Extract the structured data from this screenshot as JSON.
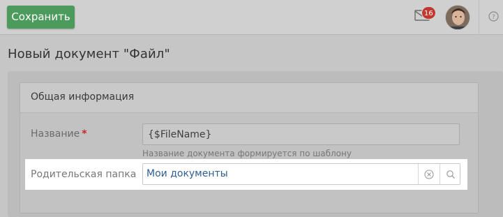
{
  "toolbar": {
    "save_label": "Сохранить",
    "notifications_count": "16",
    "mail_icon": "envelope-icon",
    "help_icon": "question-circle-icon"
  },
  "page": {
    "title": "Новый документ \"Файл\""
  },
  "section": {
    "title": "Общая информация"
  },
  "fields": {
    "name": {
      "label": "Название",
      "required_mark": "*",
      "value": "{$FileName}",
      "hint": "Название документа формируется по шаблону"
    },
    "parent_folder": {
      "label": "Родительская папка",
      "value": "Мои документы"
    }
  },
  "colors": {
    "accent_green": "#4c9a5c",
    "badge_red": "#c23a2f",
    "link_blue": "#2f5f94",
    "required_red": "#c62828"
  }
}
